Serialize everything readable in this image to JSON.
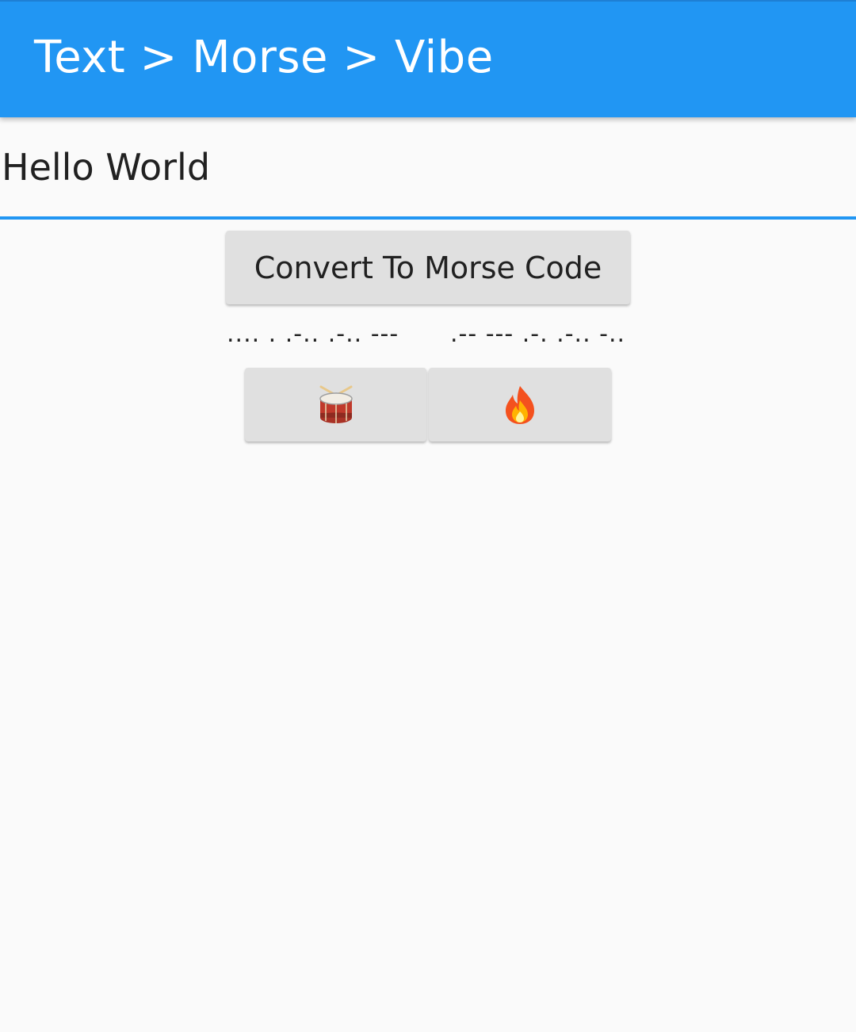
{
  "app_bar": {
    "title": "Text > Morse > Vibe",
    "color": "#2196f3"
  },
  "input": {
    "value": "Hello World"
  },
  "convert_button": {
    "label": "Convert To Morse Code"
  },
  "morse_output": {
    "words": [
      ".... . .-.. .-.. ---",
      ".-- --- .-. .-.. -.."
    ]
  },
  "action_buttons": [
    {
      "icon": "drum-icon"
    },
    {
      "icon": "fire-icon"
    }
  ],
  "colors": {
    "background": "#fafafa",
    "button": "#e0e0e0",
    "accent": "#2196f3"
  }
}
